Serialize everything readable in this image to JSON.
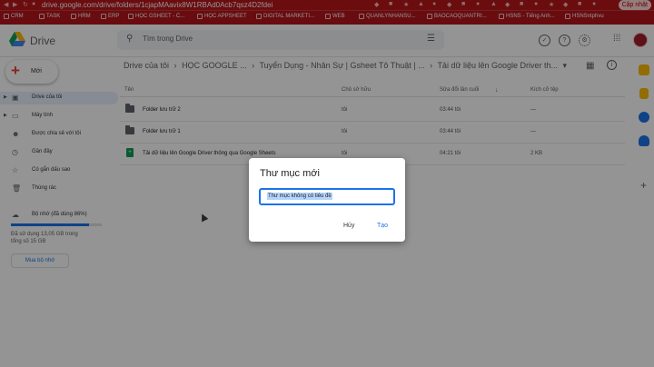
{
  "browser": {
    "url": "drive.google.com/drive/folders/1cjapMAavix8W1RBAd0Acb7qsz4D2fdei",
    "update_label": "Cập nhật",
    "bookmarks": [
      "CRM",
      "TASK",
      "HRM",
      "ERP",
      "HỌC GSHEET - C...",
      "HỌC APPSHEET",
      "DIGITAL MARKETI...",
      "WEB",
      "QUANLYNHANSU...",
      "BAOCAOQUANTRI...",
      "HSNS - Tiếng Anh...",
      "HSNSntphvu"
    ]
  },
  "header": {
    "app_name": "Drive",
    "search_placeholder": "Tìm trong Drive"
  },
  "sidebar": {
    "new_label": "Mới",
    "items": [
      {
        "label": "Drive của tôi",
        "icon": "drive-icon"
      },
      {
        "label": "Máy tính",
        "icon": "computer-icon"
      },
      {
        "label": "Được chia sẻ với tôi",
        "icon": "shared-icon"
      },
      {
        "label": "Gần đây",
        "icon": "clock-icon"
      },
      {
        "label": "Có gắn dấu sao",
        "icon": "star-icon"
      },
      {
        "label": "Thùng rác",
        "icon": "trash-icon"
      }
    ],
    "storage_label": "Bộ nhớ (đã dùng 86%)",
    "storage_percent": 86,
    "storage_detail_1": "Đã sử dụng 13,05 GB trong",
    "storage_detail_2": "tổng số 15 GB",
    "buy_label": "Mua bộ nhớ"
  },
  "main": {
    "breadcrumbs": [
      "Drive của tôi",
      "HỌC GOOGLE ...",
      "Tuyển Dụng - Nhân Sự | Gsheet Tô Thuật | ...",
      "Tải dữ liệu lên Google Driver th..."
    ],
    "columns": {
      "name": "Tên",
      "owner": "Chủ sở hữu",
      "modified": "Sửa đổi lần cuối",
      "size": "Kích cỡ tệp"
    },
    "rows": [
      {
        "name": "Folder lưu trữ 2",
        "owner": "tôi",
        "modified": "03:44 tôi",
        "size": "—",
        "type": "folder"
      },
      {
        "name": "Folder lưu trữ 1",
        "owner": "tôi",
        "modified": "03:44 tôi",
        "size": "—",
        "type": "folder"
      },
      {
        "name": "Tải dữ liệu lên Google Driver thông qua Google Sheets",
        "owner": "tôi",
        "modified": "04:21 tôi",
        "size": "2 KB",
        "type": "sheet"
      }
    ]
  },
  "dialog": {
    "title": "Thư mục mới",
    "input_value": "Thư mục không có tiêu đề",
    "cancel_label": "Hủy",
    "create_label": "Tạo"
  },
  "colors": {
    "accent": "#1a73e8",
    "chrome_red": "#b9151b",
    "new_plus": "#ea4335"
  }
}
